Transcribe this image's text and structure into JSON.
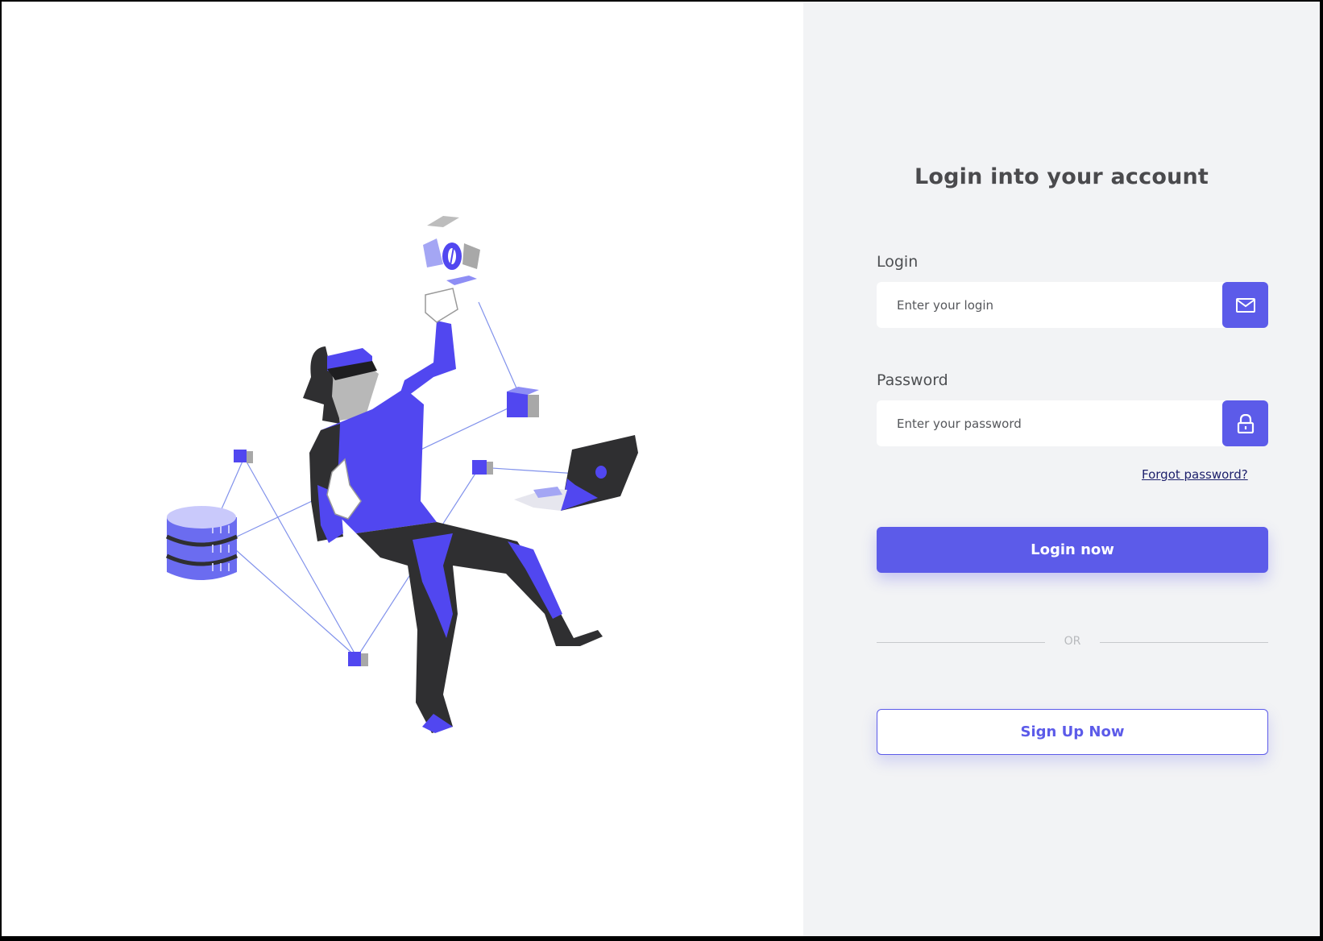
{
  "login_panel": {
    "title": "Login into your account",
    "login_label": "Login",
    "login_placeholder": "Enter your login",
    "login_icon": "mail-icon",
    "password_label": "Password",
    "password_placeholder": "Enter your password",
    "password_icon": "lock-icon",
    "forgot_link": "Forgot password?",
    "login_button": "Login now",
    "divider_text": "OR",
    "signup_button": "Sign Up Now"
  },
  "colors": {
    "accent": "#5c5be9",
    "panel_bg": "#f2f3f5",
    "title_text": "#4a4a4d",
    "link": "#1c1f6b",
    "figure_dark": "#2f2f31",
    "figure_light": "#c7c7f7"
  }
}
